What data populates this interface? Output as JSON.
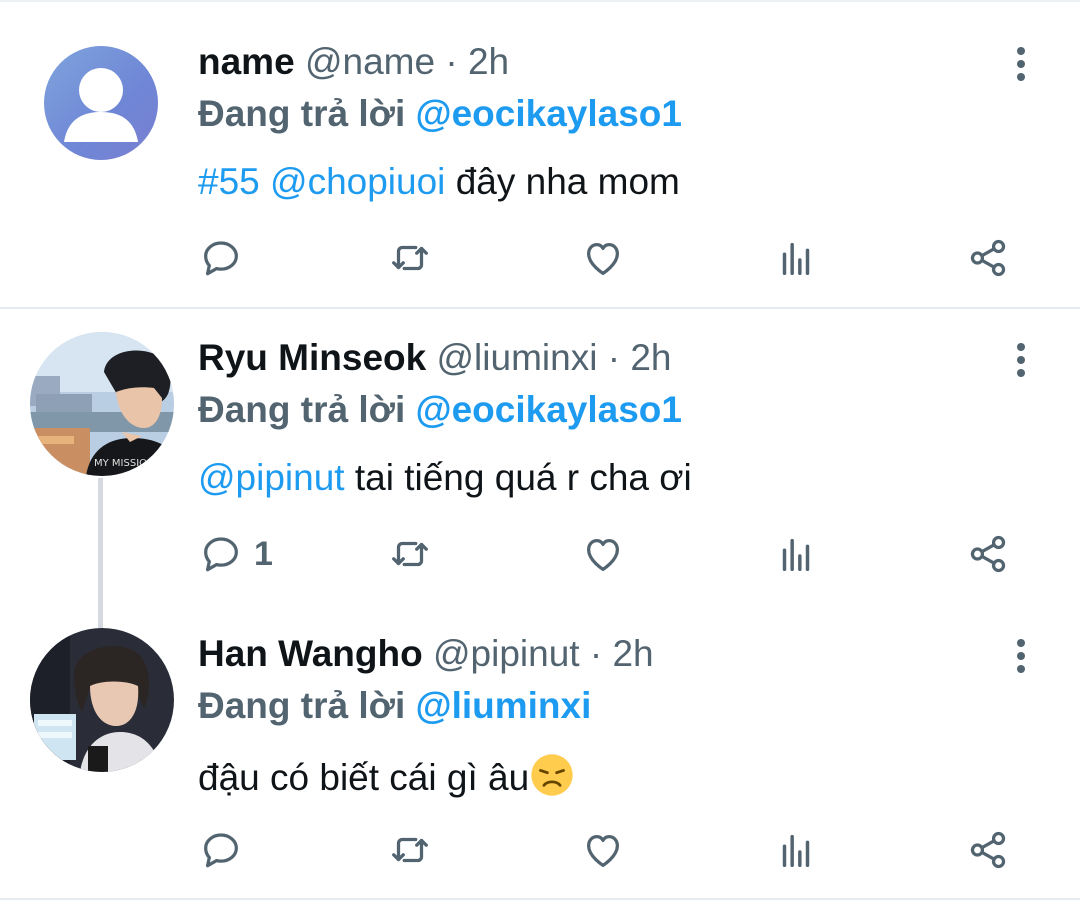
{
  "tweets": [
    {
      "name": "name",
      "handle": "@name",
      "time": "2h",
      "reply_prefix": "Đang trả lời",
      "reply_to": "@eocikaylaso1",
      "text_parts": {
        "hashtag": "#55",
        "mention": "@chopiuoi",
        "rest": "đây nha mom"
      },
      "reply_count": ""
    },
    {
      "name": "Ryu Minseok",
      "handle": "@liuminxi",
      "time": "2h",
      "reply_prefix": "Đang trả lời",
      "reply_to": "@eocikaylaso1",
      "text_parts": {
        "mention": "@pipinut",
        "rest": "tai tiếng quá r cha ơi"
      },
      "reply_count": "1"
    },
    {
      "name": "Han Wangho",
      "handle": "@pipinut",
      "time": "2h",
      "reply_prefix": "Đang trả lời",
      "reply_to": "@liuminxi",
      "text_parts": {
        "rest": "đậu có biết cái gì âu",
        "emoji": "disappointed-face"
      },
      "reply_count": ""
    }
  ],
  "separator": "·",
  "colors": {
    "link": "#1d9bf0",
    "muted": "#536471",
    "text": "#0f1419"
  },
  "icons": [
    "reply-icon",
    "retweet-icon",
    "like-icon",
    "stats-icon",
    "share-icon",
    "more-icon"
  ]
}
